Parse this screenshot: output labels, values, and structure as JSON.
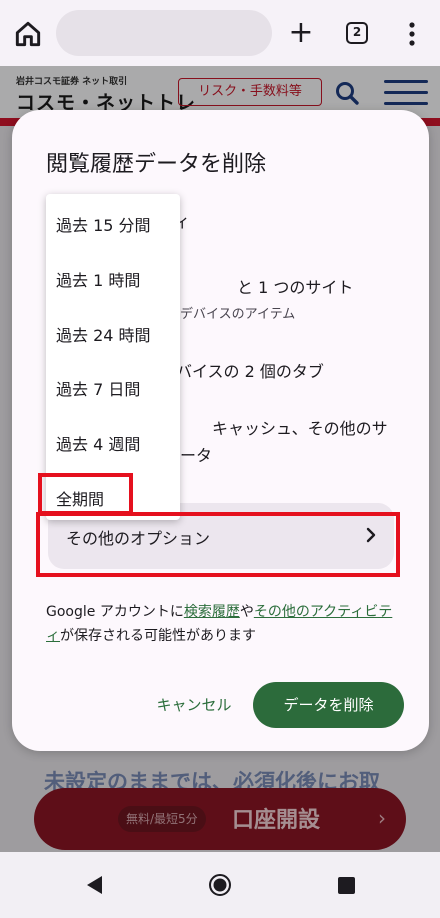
{
  "browser": {
    "tab_count": "2",
    "plus_label": "+"
  },
  "site": {
    "logo_tagline": "岩井コスモ証券 ネット取引",
    "logo_name": "コスモ・ネットトレ",
    "risk_button": "リスク・手数料等",
    "bg_heading": "未設定のままでは、必須化後にお取",
    "cta_badge": "無料/最短5分",
    "cta_label": "口座開設",
    "cta_arrow": "›"
  },
  "dialog": {
    "title": "閲覧履歴データを削除",
    "partials": [
      "ィ",
      "と 1 つのサイト",
      "デバイスのアイテム",
      "バイスの 2 個のタブ",
      "キャッシュ、その他のサ",
      "ータ"
    ],
    "more_options": "その他のオプション",
    "footnote": {
      "prefix": "Google アカウントに",
      "link1": "検索履歴",
      "middle": "や",
      "link2": "その他のアクティビティ",
      "suffix": "が保存される可能性があります"
    },
    "cancel_label": "キャンセル",
    "delete_label": "データを削除"
  },
  "dropdown": {
    "options": [
      "過去 15 分間",
      "過去 1 時間",
      "過去 24 時間",
      "過去 7 日間",
      "過去 4 週間",
      "全期間"
    ]
  },
  "colors": {
    "accent_green": "#2c6b3b",
    "highlight_red": "#e5101e",
    "brand_red": "#d3152f",
    "brand_navy": "#1e3d80"
  },
  "icons": [
    "home-icon",
    "plus-icon",
    "tab-switcher-icon",
    "more-vert-icon",
    "search-icon",
    "hamburger-icon",
    "chevron-right-icon",
    "nav-back-icon",
    "nav-home-icon",
    "nav-recents-icon"
  ]
}
